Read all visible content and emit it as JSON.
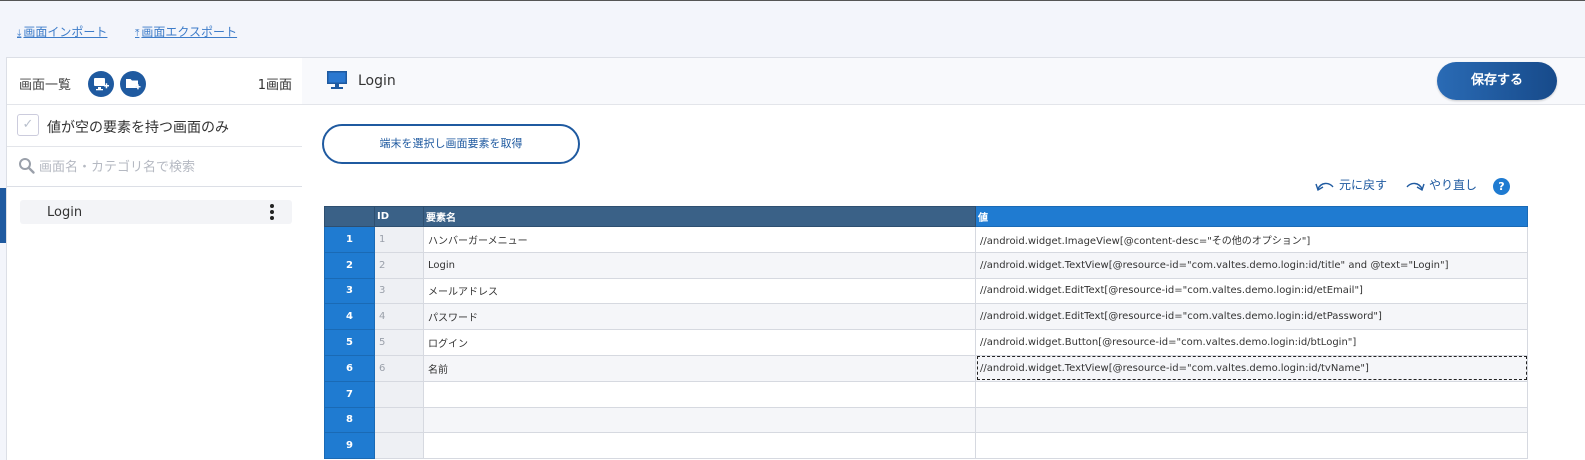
{
  "toolbar": {
    "import_label": "画面インポート",
    "export_label": "画面エクスポート"
  },
  "left_panel": {
    "title": "画面一覧",
    "count": "1画面",
    "filter_label": "値が空の要素を持つ画面のみ",
    "search_placeholder": "画面名・カテゴリ名で検索",
    "screens": [
      {
        "name": "Login"
      }
    ]
  },
  "main": {
    "screen_title": "Login",
    "save_label": "保存する",
    "fetch_label": "端末を選択し画面要素を取得",
    "undo_label": "元に戻す",
    "redo_label": "やり直し",
    "help_label": "?"
  },
  "grid": {
    "headers": {
      "id": "ID",
      "name": "要素名",
      "value": "値"
    },
    "rows": [
      {
        "num": "1",
        "id": "1",
        "name": "ハンバーガーメニュー",
        "value": "//android.widget.ImageView[@content-desc=\"その他のオプション\"]"
      },
      {
        "num": "2",
        "id": "2",
        "name": "Login",
        "value": "//android.widget.TextView[@resource-id=\"com.valtes.demo.login:id/title\" and @text=\"Login\"]"
      },
      {
        "num": "3",
        "id": "3",
        "name": "メールアドレス",
        "value": "//android.widget.EditText[@resource-id=\"com.valtes.demo.login:id/etEmail\"]"
      },
      {
        "num": "4",
        "id": "4",
        "name": "パスワード",
        "value": "//android.widget.EditText[@resource-id=\"com.valtes.demo.login:id/etPassword\"]"
      },
      {
        "num": "5",
        "id": "5",
        "name": "ログイン",
        "value": "//android.widget.Button[@resource-id=\"com.valtes.demo.login:id/btLogin\"]"
      },
      {
        "num": "6",
        "id": "6",
        "name": "名前",
        "value": "//android.widget.TextView[@resource-id=\"com.valtes.demo.login:id/tvName\"]"
      },
      {
        "num": "7",
        "id": "",
        "name": "",
        "value": ""
      },
      {
        "num": "8",
        "id": "",
        "name": "",
        "value": ""
      },
      {
        "num": "9",
        "id": "",
        "name": "",
        "value": ""
      }
    ]
  },
  "colors": {
    "accent": "#1f5aa0",
    "header_dark": "#3a6187",
    "header_blue": "#1f7bd1"
  }
}
